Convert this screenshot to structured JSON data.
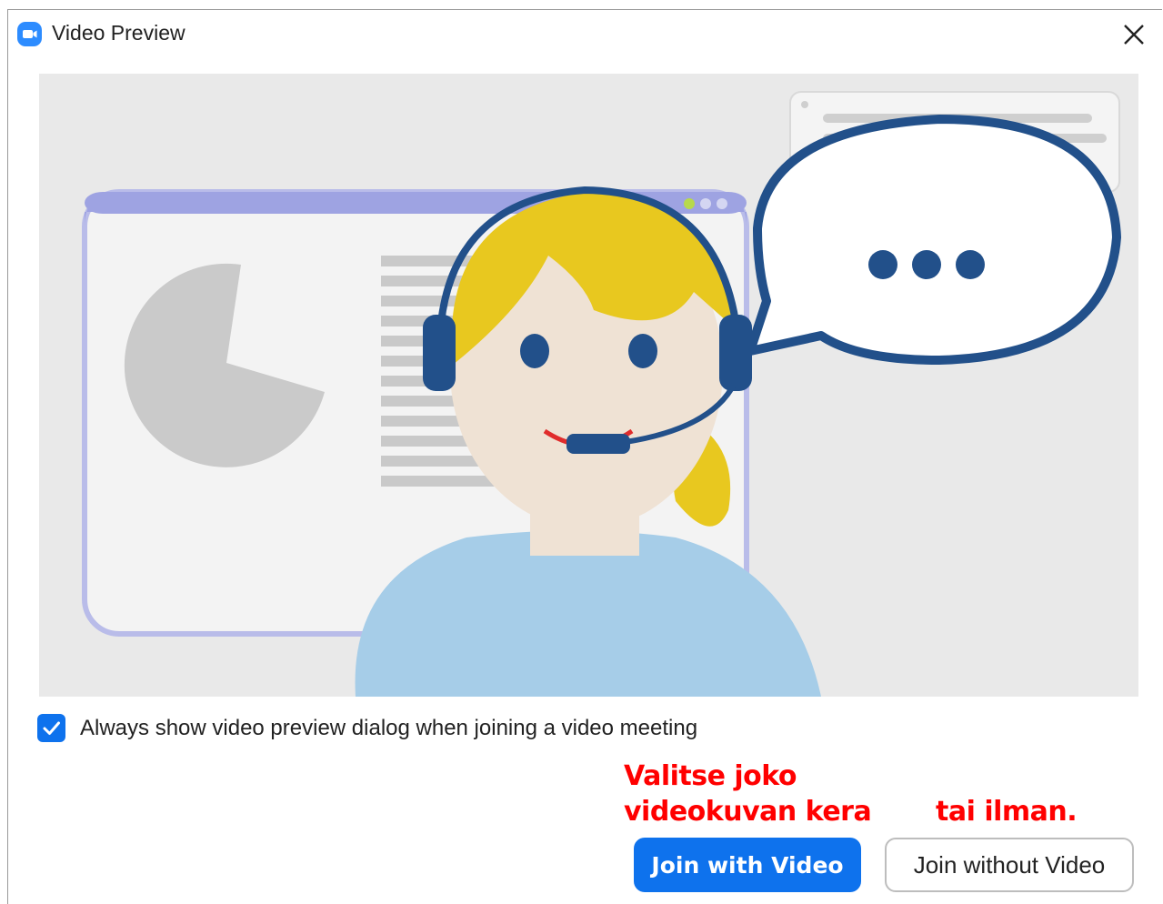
{
  "window": {
    "title": "Video Preview",
    "app_icon": "zoom-camera-icon",
    "close_icon": "close-icon"
  },
  "preview": {
    "illustration": "person-with-headset-illustration"
  },
  "checkbox": {
    "label": "Always show video preview dialog when joining a video meeting",
    "checked": true
  },
  "annotations": {
    "line1": "Valitse joko",
    "line2": "videokuvan kera",
    "line3": "tai ilman.",
    "color": "#ff0000"
  },
  "buttons": {
    "join_with_video": "Join with Video",
    "join_without_video": "Join without Video"
  },
  "colors": {
    "accent": "#0e72ed",
    "zoom_brand": "#2d8cff"
  }
}
